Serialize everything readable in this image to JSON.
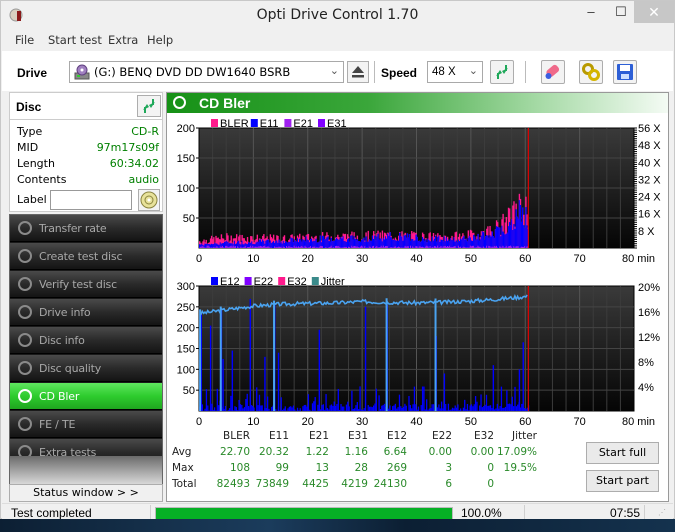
{
  "window": {
    "title": "Opti Drive Control 1.70",
    "controls": {
      "minimize": "‒",
      "maximize": "☐",
      "close": "✕"
    }
  },
  "menu": [
    "File",
    "Start test",
    "Extra",
    "Help"
  ],
  "toolbar": {
    "drive_label": "Drive",
    "drive_value": "(G:)   BENQ DVD DD DW1640 BSRB",
    "speed_label": "Speed",
    "speed_value": "48 X",
    "icons": [
      "eject-icon",
      "refresh-icon",
      "erase-icon",
      "settings-icon",
      "save-icon"
    ]
  },
  "disc": {
    "title": "Disc",
    "rows": [
      {
        "key": "Type",
        "value": "CD-R"
      },
      {
        "key": "MID",
        "value": "97m17s09f"
      },
      {
        "key": "Length",
        "value": "60:34.02"
      },
      {
        "key": "Contents",
        "value": "audio"
      }
    ],
    "label_label": "Label",
    "label_value": ""
  },
  "nav": [
    {
      "label": "Transfer rate",
      "active": false
    },
    {
      "label": "Create test disc",
      "active": false
    },
    {
      "label": "Verify test disc",
      "active": false
    },
    {
      "label": "Drive info",
      "active": false
    },
    {
      "label": "Disc info",
      "active": false
    },
    {
      "label": "Disc quality",
      "active": false
    },
    {
      "label": "CD Bler",
      "active": true
    },
    {
      "label": "FE / TE",
      "active": false
    },
    {
      "label": "Extra tests",
      "active": false
    }
  ],
  "status_window_button": "Status window > >",
  "main": {
    "title": "CD Bler"
  },
  "chart_data": [
    {
      "type": "bar",
      "title": "BLER / E11 / E21 / E31",
      "legend": [
        {
          "name": "BLER",
          "color": "#ff1a8c"
        },
        {
          "name": "E11",
          "color": "#0000ff"
        },
        {
          "name": "E21",
          "color": "#a020f0"
        },
        {
          "name": "E31",
          "color": "#8000ff"
        }
      ],
      "x_ticks": [
        "0",
        "10",
        "20",
        "30",
        "40",
        "50",
        "60",
        "70",
        "80 min"
      ],
      "xlim": [
        0,
        80
      ],
      "y_ticks": [
        "50",
        "100",
        "150",
        "200"
      ],
      "ylim": [
        0,
        200
      ],
      "y2_ticks": [
        "8 X",
        "16 X",
        "24 X",
        "32 X",
        "40 X",
        "48 X",
        "56 X"
      ],
      "y2lim": [
        0,
        56
      ],
      "end_marker_min": 60.57,
      "series_profile": {
        "BLER": {
          "x_min": [
            0,
            5,
            10,
            15,
            20,
            25,
            30,
            35,
            40,
            45,
            50,
            53,
            55,
            57,
            58,
            59,
            60,
            60.5
          ],
          "approx": [
            12,
            18,
            17,
            16,
            18,
            20,
            20,
            22,
            20,
            18,
            22,
            28,
            36,
            50,
            60,
            70,
            65,
            55
          ]
        },
        "E11": {
          "x_min": [
            0,
            5,
            10,
            15,
            20,
            25,
            30,
            35,
            40,
            45,
            50,
            53,
            55,
            57,
            58,
            59,
            60,
            60.5
          ],
          "approx": [
            6,
            9,
            10,
            12,
            15,
            17,
            17,
            19,
            18,
            16,
            18,
            22,
            30,
            42,
            52,
            60,
            55,
            48
          ]
        }
      },
      "grid": true
    },
    {
      "type": "bar",
      "title": "E12 / E22 / E32 / Jitter",
      "legend": [
        {
          "name": "E12",
          "color": "#0000ff"
        },
        {
          "name": "E22",
          "color": "#8000ff"
        },
        {
          "name": "E32",
          "color": "#ff1a8c"
        },
        {
          "name": "Jitter",
          "color": "#3a8a8a"
        }
      ],
      "x_ticks": [
        "0",
        "10",
        "20",
        "30",
        "40",
        "50",
        "60",
        "70",
        "80 min"
      ],
      "xlim": [
        0,
        80
      ],
      "y_ticks": [
        "50",
        "100",
        "150",
        "200",
        "250",
        "300"
      ],
      "ylim": [
        0,
        300
      ],
      "y2_ticks": [
        "4%",
        "8%",
        "12%",
        "16%",
        "20%"
      ],
      "y2lim": [
        0,
        20
      ],
      "end_marker_min": 60.57,
      "e12_spikes": [
        {
          "x": 0.3,
          "y": 235
        },
        {
          "x": 2,
          "y": 205
        },
        {
          "x": 4,
          "y": 245
        },
        {
          "x": 4.3,
          "y": 125
        },
        {
          "x": 6,
          "y": 145
        },
        {
          "x": 9.3,
          "y": 269
        },
        {
          "x": 12,
          "y": 130
        },
        {
          "x": 13.8,
          "y": 255
        },
        {
          "x": 14.5,
          "y": 140
        },
        {
          "x": 22,
          "y": 195
        },
        {
          "x": 30.5,
          "y": 250
        },
        {
          "x": 34.5,
          "y": 255
        },
        {
          "x": 43.5,
          "y": 180
        },
        {
          "x": 45,
          "y": 90
        },
        {
          "x": 54,
          "y": 110
        },
        {
          "x": 59.5,
          "y": 165
        },
        {
          "x": 58.8,
          "y": 100
        }
      ],
      "jitter_profile": {
        "x_min": [
          0,
          5,
          10,
          15,
          20,
          25,
          30,
          35,
          40,
          45,
          50,
          55,
          60,
          60.5
        ],
        "percent": [
          15.6,
          16.2,
          16.8,
          17.1,
          17.2,
          17.3,
          17.5,
          17.4,
          17.3,
          17.4,
          17.6,
          17.9,
          18.3,
          18.4
        ]
      },
      "jitter_drops_min": [
        0.2,
        4,
        13.8,
        34.5,
        43.5
      ],
      "grid": true
    }
  ],
  "stats": {
    "columns": [
      "BLER",
      "E11",
      "E21",
      "E31",
      "E12",
      "E22",
      "E32",
      "Jitter"
    ],
    "rows": [
      {
        "label": "Avg",
        "values": [
          "22.70",
          "20.32",
          "1.22",
          "1.16",
          "6.64",
          "0.00",
          "0.00",
          "17.09%"
        ]
      },
      {
        "label": "Max",
        "values": [
          "108",
          "99",
          "13",
          "28",
          "269",
          "3",
          "0",
          "19.5%"
        ]
      },
      {
        "label": "Total",
        "values": [
          "82493",
          "73849",
          "4425",
          "4219",
          "24130",
          "6",
          "0",
          ""
        ]
      }
    ]
  },
  "buttons": {
    "start_full": "Start full",
    "start_part": "Start part"
  },
  "statusbar": {
    "text": "Test completed",
    "progress_percent": 100.0,
    "progress_text": "100.0%",
    "time": "07:55"
  }
}
